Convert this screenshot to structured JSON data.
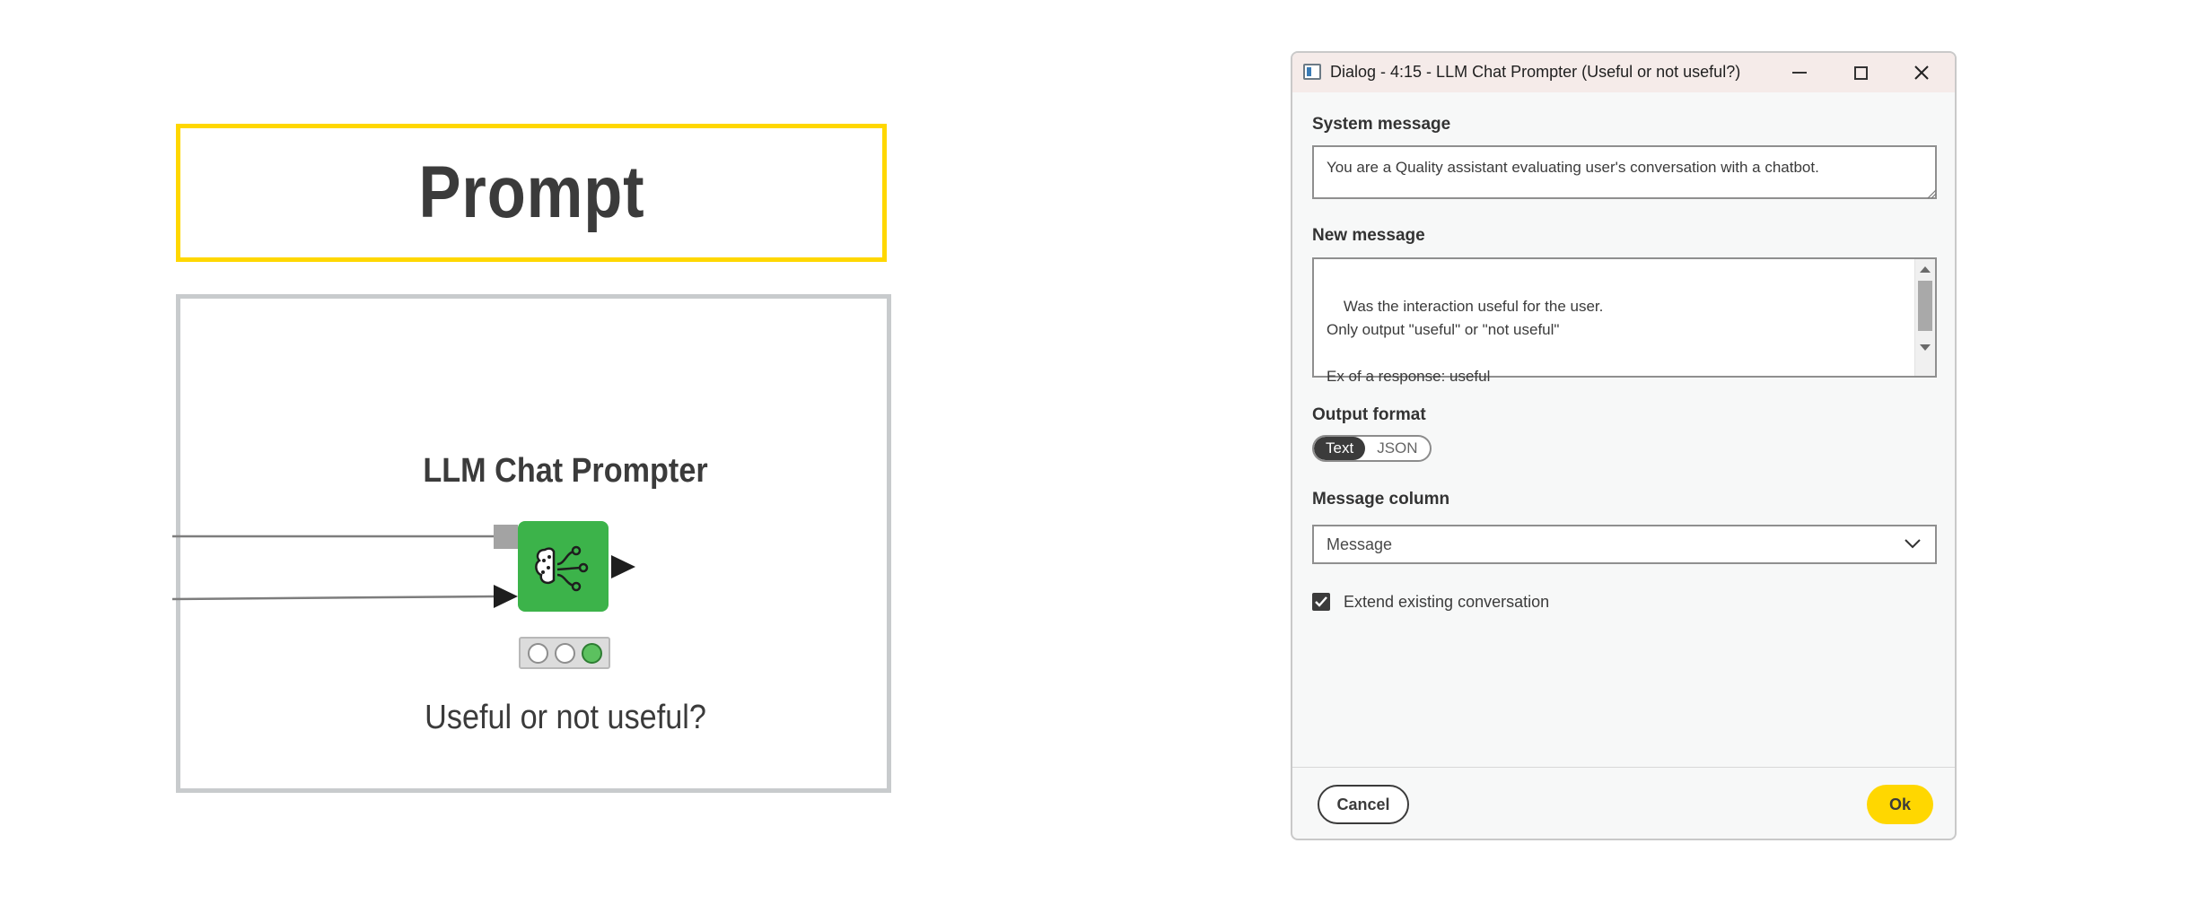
{
  "canvas": {
    "annotation_title": "Prompt",
    "node": {
      "name": "LLM Chat Prompter",
      "label": "Useful or not useful?",
      "icon": "llm-brain-icon",
      "status_lights": [
        "off",
        "off",
        "green"
      ]
    }
  },
  "dialog": {
    "title": "Dialog - 4:15 - LLM Chat Prompter (Useful or not useful?)",
    "system_message": {
      "label": "System message",
      "value": "You are a Quality assistant evaluating user's conversation with a chatbot."
    },
    "new_message": {
      "label": "New message",
      "value": "Was the interaction useful for the user.\nOnly output \"useful\" or \"not useful\"\n\nEx of a response: useful"
    },
    "output_format": {
      "label": "Output format",
      "options": [
        "Text",
        "JSON"
      ],
      "selected": "Text"
    },
    "message_column": {
      "label": "Message column",
      "value": "Message"
    },
    "extend_conversation": {
      "label": "Extend existing conversation",
      "checked": true
    },
    "cancel_label": "Cancel",
    "ok_label": "Ok"
  }
}
